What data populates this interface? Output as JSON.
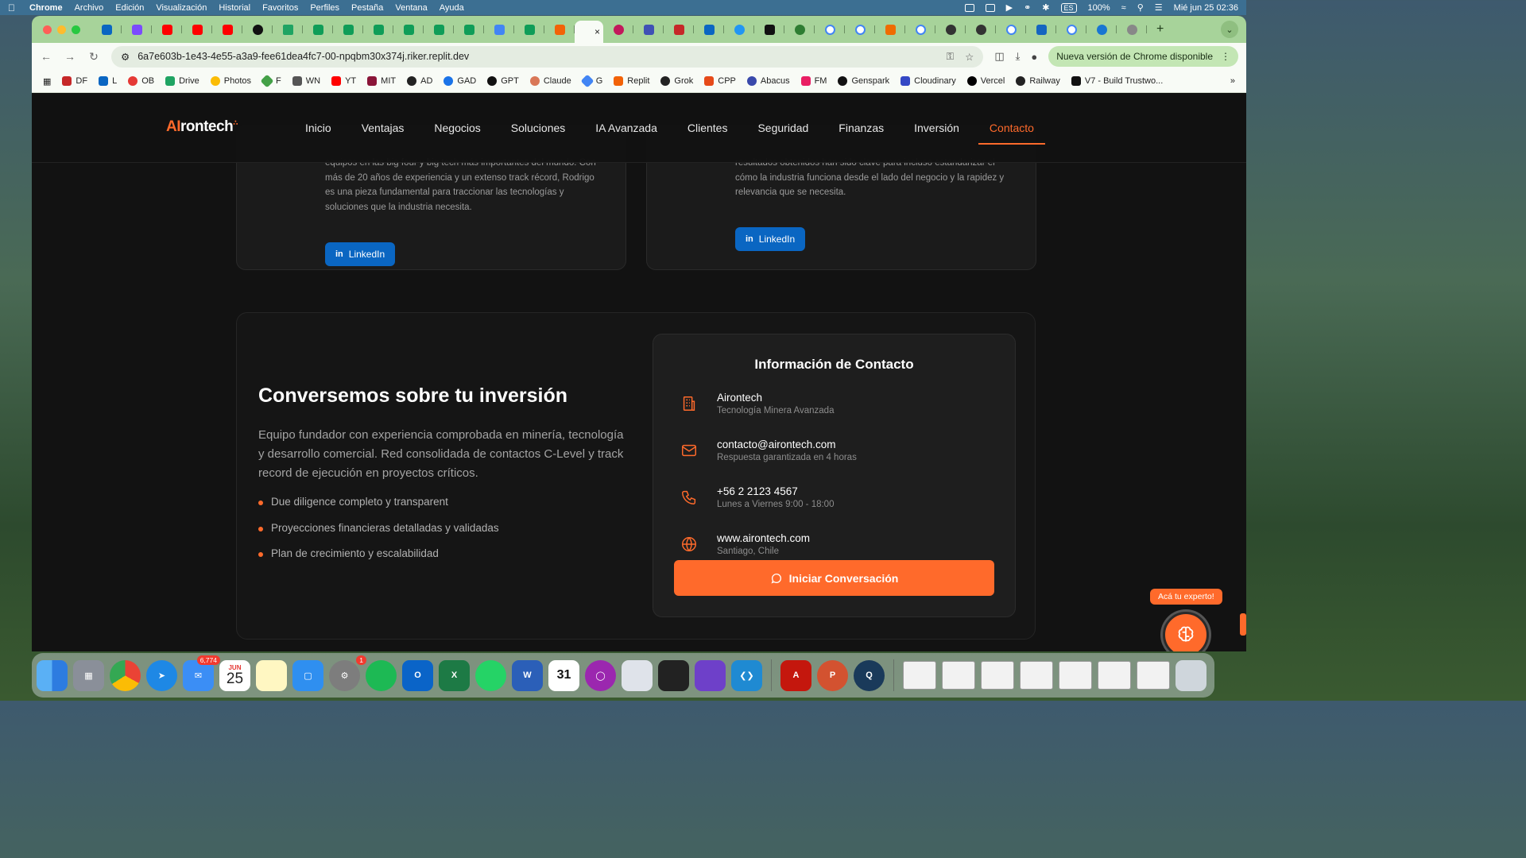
{
  "menubar": {
    "app": "Chrome",
    "menus": [
      "Archivo",
      "Edición",
      "Visualización",
      "Historial",
      "Favoritos",
      "Perfiles",
      "Pestaña",
      "Ventana",
      "Ayuda"
    ],
    "keyboard": "ES",
    "battery": "100%",
    "datetime": "Mié jun 25  02:36"
  },
  "browser": {
    "active_tab_close": "×",
    "address": "6a7e603b-1e43-4e55-a3a9-fee61dea4fc7-00-npqbm30x374j.riker.replit.dev",
    "update_label": "Nueva versión de Chrome disponible",
    "bookmarks": [
      "DF",
      "L",
      "OB",
      "Drive",
      "Photos",
      "F",
      "WN",
      "YT",
      "MIT",
      "AD",
      "GAD",
      "GPT",
      "Claude",
      "G",
      "Replit",
      "Grok",
      "CPP",
      "Abacus",
      "FM",
      "Genspark",
      "Cloudinary",
      "Vercel",
      "Railway",
      "V7 - Build Trustwo..."
    ]
  },
  "site": {
    "logo": {
      "ai": "AI",
      "rest": "rontech"
    },
    "nav": [
      "Inicio",
      "Ventajas",
      "Negocios",
      "Soluciones",
      "IA Avanzada",
      "Clientes",
      "Seguridad",
      "Finanzas",
      "Inversión",
      "Contacto"
    ],
    "team": {
      "left_text": "equipos en las big four y big tech más importantes del mundo. Con más de 20 años de experiencia y un extenso track récord, Rodrigo es una pieza fundamental para traccionar las tecnologías y soluciones que la industria necesita.",
      "right_text": "resultados obtenidos han sido clave para incluso estandarizar el cómo la industria funciona desde el lado del negocio y la rapidez y relevancia que se necesita.",
      "linkedin_label": "LinkedIn"
    },
    "contact": {
      "title": "Conversemos sobre tu inversión",
      "description": "Equipo fundador con experiencia comprobada en minería, tecnología y desarrollo comercial. Red consolidada de contactos C-Level y track record de ejecución en proyectos críticos.",
      "bullets": [
        "Due diligence completo y transparent",
        "Proyecciones financieras detalladas y validadas",
        "Plan de crecimiento y escalabilidad"
      ],
      "info_title": "Información de Contacto",
      "items": [
        {
          "main": "Airontech",
          "sub": "Tecnología Minera Avanzada",
          "icon": "building-icon"
        },
        {
          "main": "contacto@airontech.com",
          "sub": "Respuesta garantizada en 4 horas",
          "icon": "mail-icon"
        },
        {
          "main": "+56 2 2123 4567",
          "sub": "Lunes a Viernes 9:00 - 18:00",
          "icon": "phone-icon"
        },
        {
          "main": "www.airontech.com",
          "sub": "Santiago, Chile",
          "icon": "globe-icon"
        }
      ],
      "cta_label": "Iniciar Conversación"
    },
    "expert_badge": "Acá tu experto!"
  },
  "dock": {
    "mail_badge": "6,774",
    "calendar_month": "JUN",
    "calendar_day": "25",
    "settings_badge": "1"
  },
  "colors": {
    "accent": "#ff6a2b",
    "linkedin": "#0a66c2",
    "tabstrip": "#a7d39a"
  }
}
